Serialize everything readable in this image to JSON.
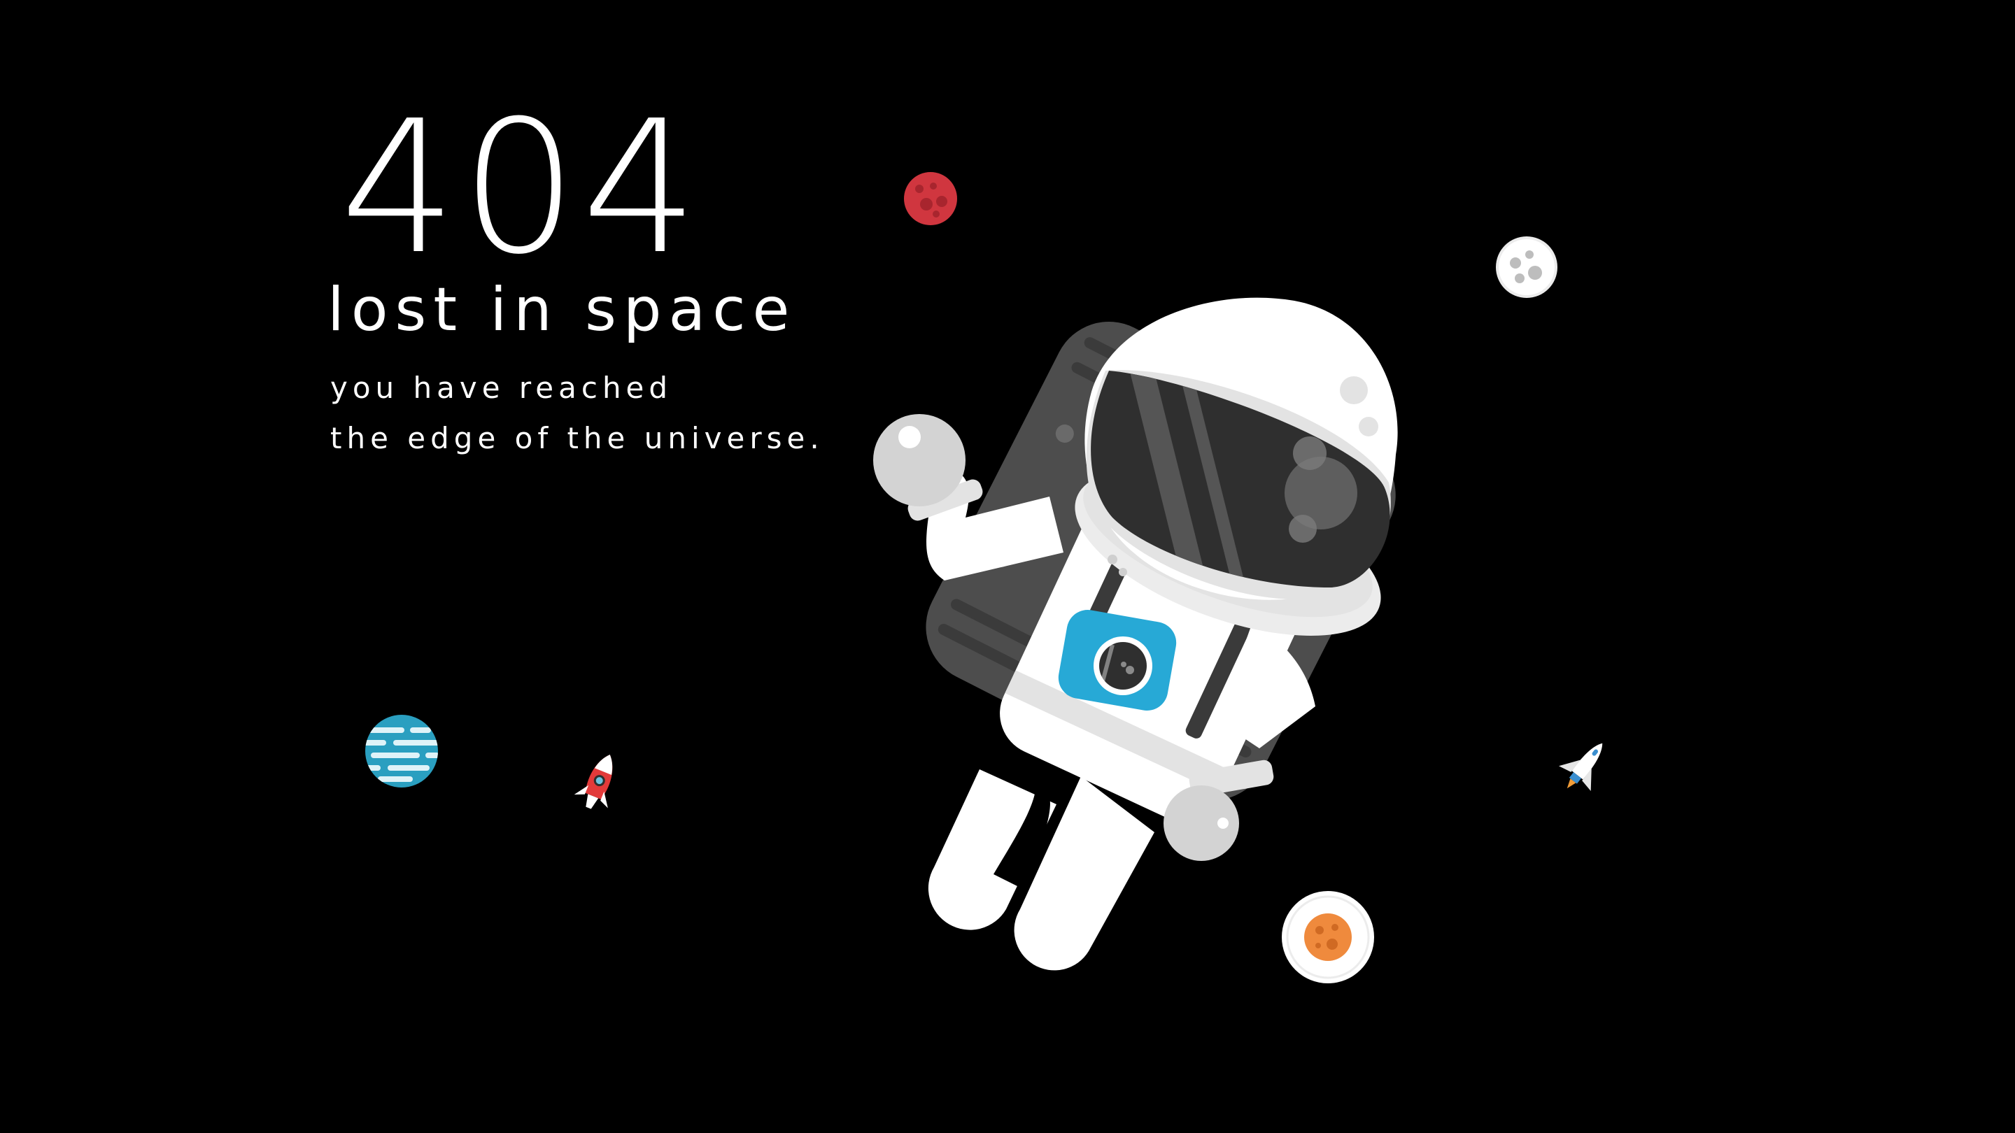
{
  "page": {
    "background_color": "#000000",
    "text_color": "#ffffff"
  },
  "message": {
    "code": "404",
    "title": "lost in space",
    "lines": [
      "you have reached",
      "the edge of the universe."
    ]
  },
  "illustration": {
    "objects": [
      "astronaut",
      "red-planet",
      "grey-moon",
      "blue-planet",
      "orange-planet",
      "red-rocket",
      "space-shuttle"
    ],
    "colors": {
      "suit": "#ffffff",
      "suit_shade": "#e3e3e3",
      "visor": "#2f2f2f",
      "backpack": "#4d4d4d",
      "badge": "#27a9d6",
      "red_planet": "#d0363f",
      "orange_planet": "#ef8a3d",
      "blue_planet": "#2a9fc0"
    }
  }
}
